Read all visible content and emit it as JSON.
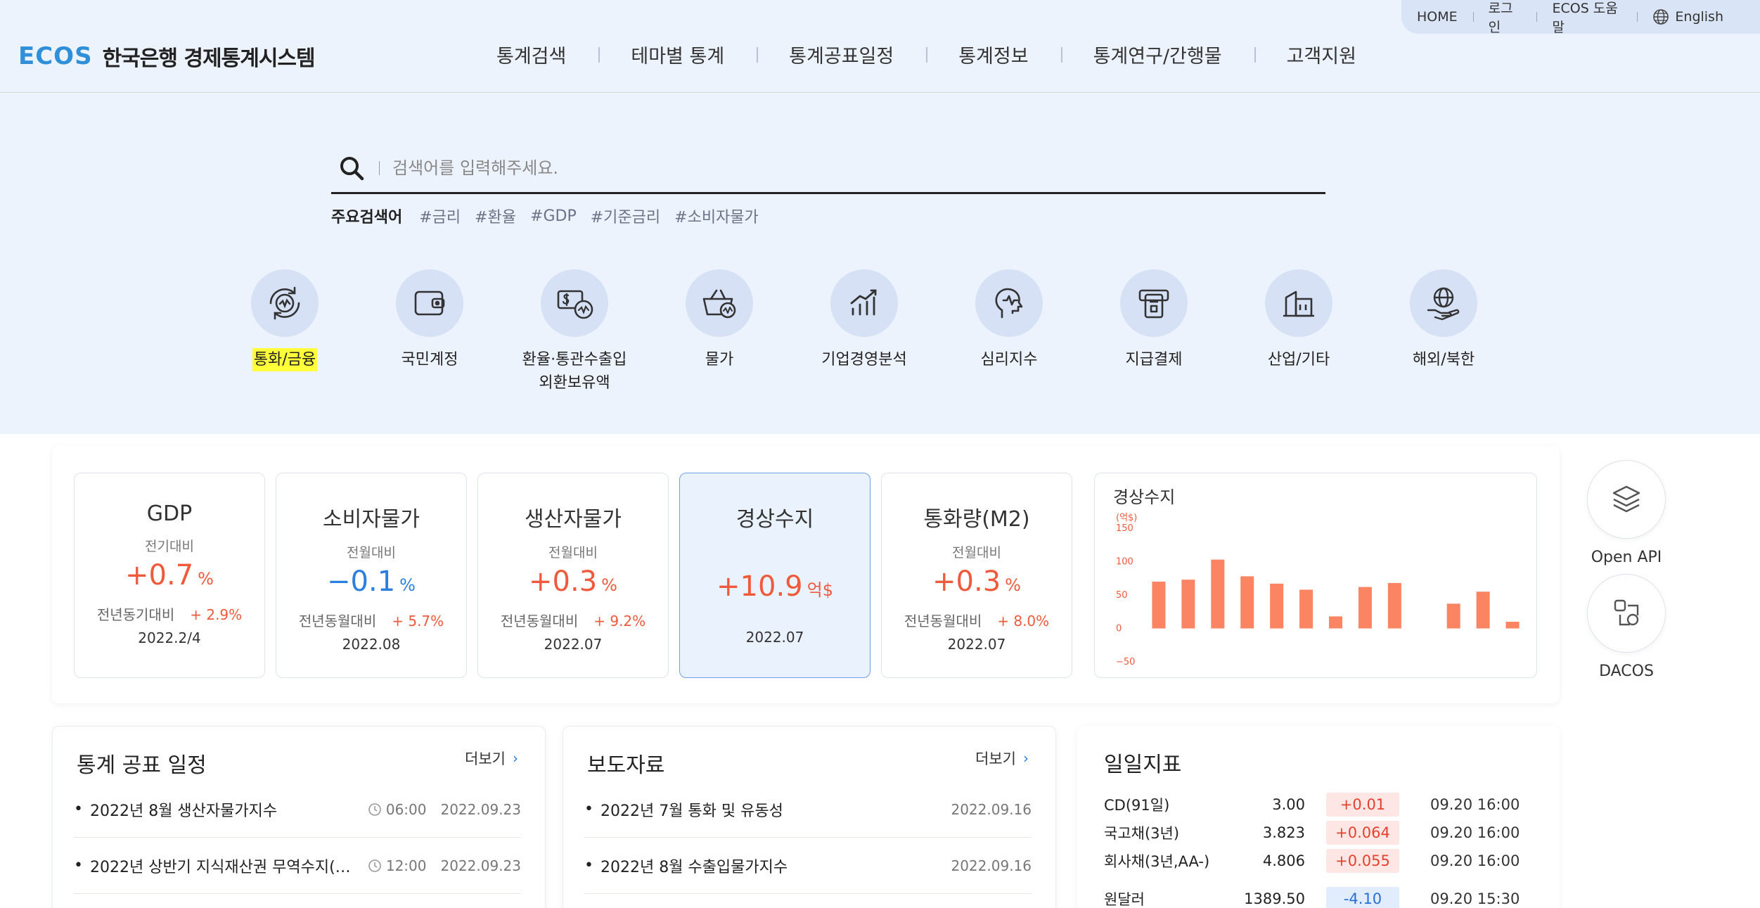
{
  "util": {
    "home": "HOME",
    "login": "로그인",
    "help": "ECOS 도움말",
    "english": "English"
  },
  "logo": {
    "brand": "ECOS",
    "org": "한국은행 경제통계시스템"
  },
  "nav": [
    "통계검색",
    "테마별 통계",
    "통계공표일정",
    "통계정보",
    "통계연구/간행물",
    "고객지원"
  ],
  "search": {
    "placeholder": "검색어를 입력해주세요.",
    "keyword_label": "주요검색어",
    "keywords": [
      "#금리",
      "#환율",
      "#GDP",
      "#기준금리",
      "#소비자물가"
    ]
  },
  "categories": [
    {
      "line1": "통화/금융",
      "line2": "",
      "icon": "currency-exchange-icon"
    },
    {
      "line1": "국민계정",
      "line2": "",
      "icon": "wallet-icon"
    },
    {
      "line1": "환율·통관수출입",
      "line2": "외환보유액",
      "icon": "money-exchange-icon"
    },
    {
      "line1": "물가",
      "line2": "",
      "icon": "shopping-basket-icon"
    },
    {
      "line1": "기업경영분석",
      "line2": "",
      "icon": "growth-chart-icon"
    },
    {
      "line1": "심리지수",
      "line2": "",
      "icon": "head-pulse-icon"
    },
    {
      "line1": "지급결제",
      "line2": "",
      "icon": "payment-terminal-icon"
    },
    {
      "line1": "산업/기타",
      "line2": "",
      "icon": "building-icon"
    },
    {
      "line1": "해외/북한",
      "line2": "",
      "icon": "globe-hand-icon"
    }
  ],
  "indicators": [
    {
      "title": "GDP",
      "compare": "전기대비",
      "sign": "+",
      "value": "0.7",
      "unit": "%",
      "sub_label": "전년동기대비",
      "sub_value": "+ 2.9%",
      "date": "2022.2/4"
    },
    {
      "title": "소비자물가",
      "compare": "전월대비",
      "sign": "−",
      "value": "0.1",
      "unit": "%",
      "sub_label": "전년동월대비",
      "sub_value": "+ 5.7%",
      "date": "2022.08"
    },
    {
      "title": "생산자물가",
      "compare": "전월대비",
      "sign": "+",
      "value": "0.3",
      "unit": "%",
      "sub_label": "전년동월대비",
      "sub_value": "+ 9.2%",
      "date": "2022.07"
    },
    {
      "title": "경상수지",
      "compare": "",
      "sign": "+",
      "value": "10.9",
      "unit": "억$",
      "sub_label": "",
      "sub_value": "",
      "date": "2022.07"
    },
    {
      "title": "통화량(M2)",
      "compare": "전월대비",
      "sign": "+",
      "value": "0.3",
      "unit": "%",
      "sub_label": "전년동월대비",
      "sub_value": "+ 8.0%",
      "date": "2022.07"
    }
  ],
  "chart_data": {
    "type": "bar",
    "title": "경상수지",
    "ylabel": "(억$)",
    "ylim": [
      -50,
      150
    ],
    "yticks": [
      "150",
      "100",
      "50",
      "0",
      "−50"
    ],
    "values": [
      70,
      73,
      103,
      78,
      67,
      58,
      18,
      62,
      68,
      null,
      37,
      55,
      10
    ],
    "color": "#fb8462"
  },
  "side": {
    "api": "Open API",
    "dacos": "DACOS"
  },
  "schedule": {
    "title": "통계 공표 일정",
    "more": "더보기",
    "rows": [
      {
        "text": "2022년 8월 생산자물가지수",
        "time": "06:00",
        "date": "2022.09.23"
      },
      {
        "text": "2022년 상반기 지식재산권 무역수지(잠…",
        "time": "12:00",
        "date": "2022.09.23"
      }
    ]
  },
  "press": {
    "title": "보도자료",
    "more": "더보기",
    "rows": [
      {
        "text": "2022년 7월 통화 및 유동성",
        "date": "2022.09.16"
      },
      {
        "text": "2022년 8월 수출입물가지수",
        "date": "2022.09.16"
      }
    ]
  },
  "daily": {
    "title": "일일지표",
    "rows": [
      {
        "name": "CD(91일)",
        "value": "3.00",
        "change": "+0.01",
        "dir": "up",
        "time": "09.20 16:00"
      },
      {
        "name": "국고채(3년)",
        "value": "3.823",
        "change": "+0.064",
        "dir": "up",
        "time": "09.20 16:00"
      },
      {
        "name": "회사채(3년,AA-)",
        "value": "4.806",
        "change": "+0.055",
        "dir": "up",
        "time": "09.20 16:00"
      },
      {
        "name": "원달러",
        "value": "1389.50",
        "change": "-4.10",
        "dir": "down",
        "time": "09.20 15:30"
      }
    ]
  },
  "colors": {
    "accent": "#2b7fe0",
    "positive": "#f05a3c",
    "hero_bg": "#edf3fd",
    "icon_bg": "#d6e1f6"
  }
}
